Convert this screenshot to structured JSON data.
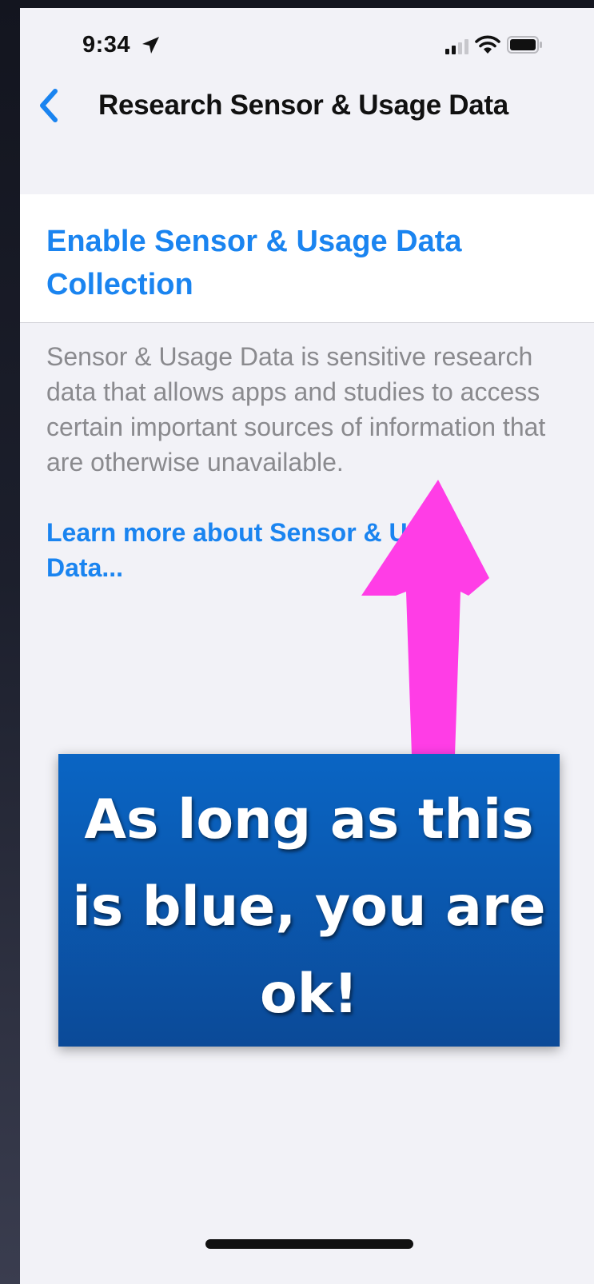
{
  "status_bar": {
    "time": "9:34",
    "icons": [
      "location-arrow-icon",
      "cellular-signal-icon",
      "wifi-icon",
      "battery-icon"
    ]
  },
  "nav": {
    "back_icon": "chevron-left-icon",
    "title": "Research Sensor & Usage Data"
  },
  "enable_cell": {
    "label": "Enable Sensor & Usage Data Collection"
  },
  "description": "Sensor & Usage Data is sensitive research data that allows apps and studies to access certain important sources of information that are otherwise unavailable.",
  "learn_more": "Learn more about Sensor & Usage Data...",
  "annotation": {
    "text": "As long as this is blue, you are ok!",
    "arrow_color": "#ff3de6",
    "box_color": "#0a5bb4"
  },
  "colors": {
    "accent": "#1a84f0",
    "background": "#f2f2f7"
  }
}
